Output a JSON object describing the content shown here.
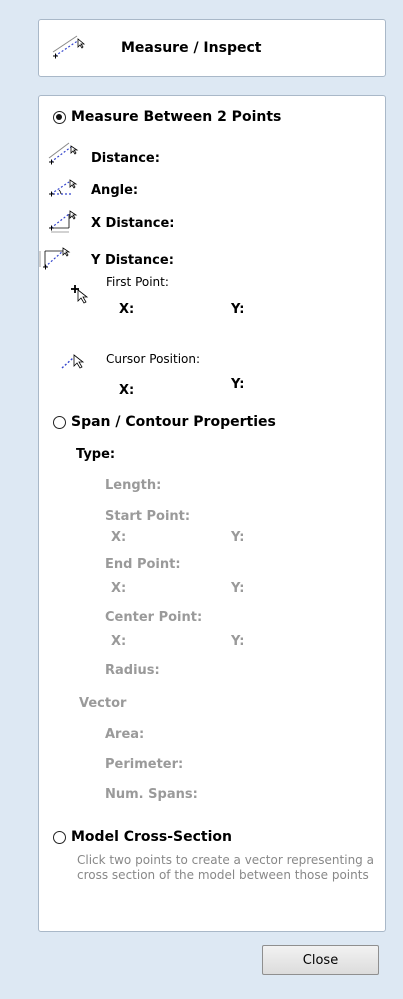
{
  "header": {
    "title": "Measure / Inspect"
  },
  "measure2": {
    "radio_label": "Measure Between 2 Points",
    "distance": "Distance:",
    "angle": "Angle:",
    "x_distance": "X Distance:",
    "y_distance": "Y Distance:",
    "first_point": "First Point:",
    "first_x": "X:",
    "first_y": "Y:",
    "cursor_position": "Cursor Position:",
    "cursor_x": "X:",
    "cursor_y": "Y:"
  },
  "span": {
    "radio_label": "Span / Contour Properties",
    "type": "Type:",
    "length": "Length:",
    "start_point": "Start Point:",
    "start_x": "X:",
    "start_y": "Y:",
    "end_point": "End Point:",
    "end_x": "X:",
    "end_y": "Y:",
    "center_point": "Center Point:",
    "center_x": "X:",
    "center_y": "Y:",
    "radius": "Radius:",
    "vector": "Vector",
    "area": "Area:",
    "perimeter": "Perimeter:",
    "num_spans": "Num. Spans:"
  },
  "cross": {
    "radio_label": "Model Cross-Section",
    "hint": "Click two points to create a vector representing a cross section of the model between those points"
  },
  "footer": {
    "close_label": "Close"
  },
  "options": {
    "selected": "Measure Between 2 Points"
  }
}
